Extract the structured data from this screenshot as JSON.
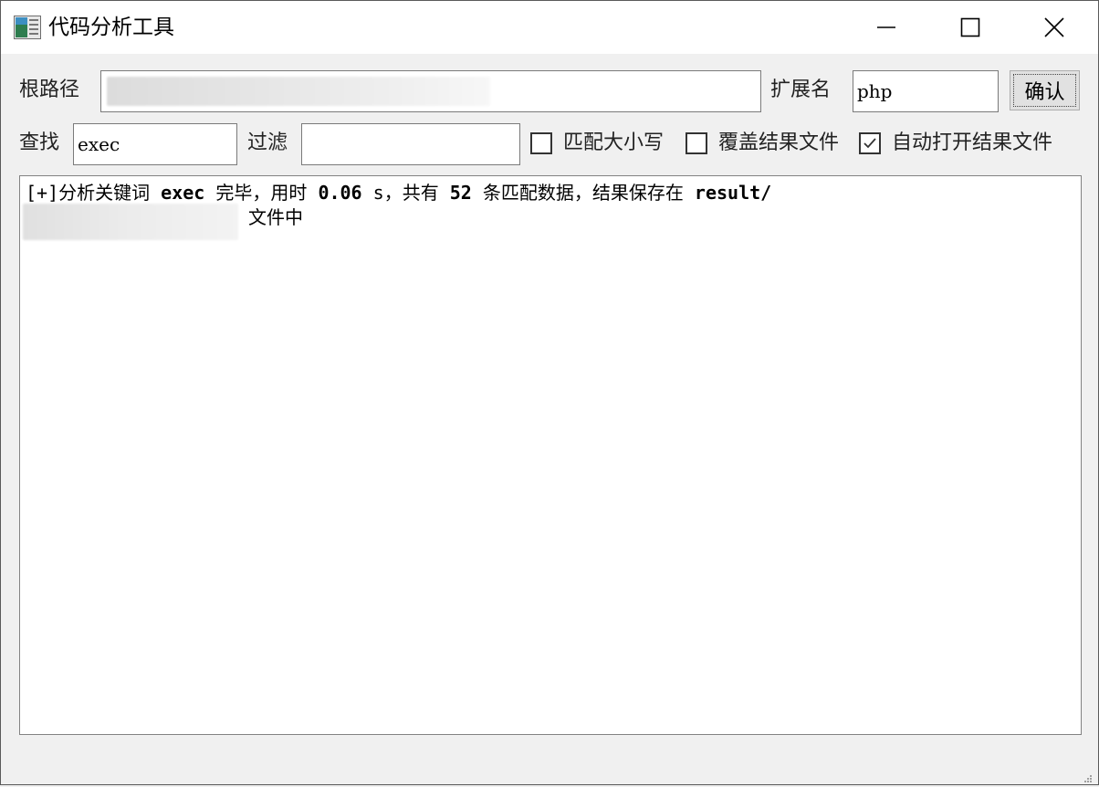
{
  "window": {
    "title": "代码分析工具",
    "app_icon": "document-icon",
    "controls": [
      "minimize-icon",
      "maximize-icon",
      "close-icon"
    ]
  },
  "form": {
    "root_path_label": "根路径",
    "root_path_value": "",
    "extension_label": "扩展名",
    "extension_value": "php",
    "confirm_label": "确认",
    "search_label": "查找",
    "search_value": "exec",
    "filter_label": "过滤",
    "filter_value": ""
  },
  "options": [
    {
      "label": "匹配大小写",
      "checked": false
    },
    {
      "label": "覆盖结果文件",
      "checked": false
    },
    {
      "label": "自动打开结果文件",
      "checked": true
    }
  ],
  "output": {
    "prefix": "[+]分析关键词 ",
    "keyword": "exec",
    "mid1": " 完毕，用时 ",
    "time": "0.06",
    "mid2": " s，共有 ",
    "count": "52",
    "mid3": " 条匹配数据，结果保存在 ",
    "path": "result/",
    "suffix": "文件中"
  },
  "colors": {
    "titlebar_bg": "#ffffff",
    "window_bg": "#f0f0f0",
    "button_bg": "#e1e1e1"
  }
}
